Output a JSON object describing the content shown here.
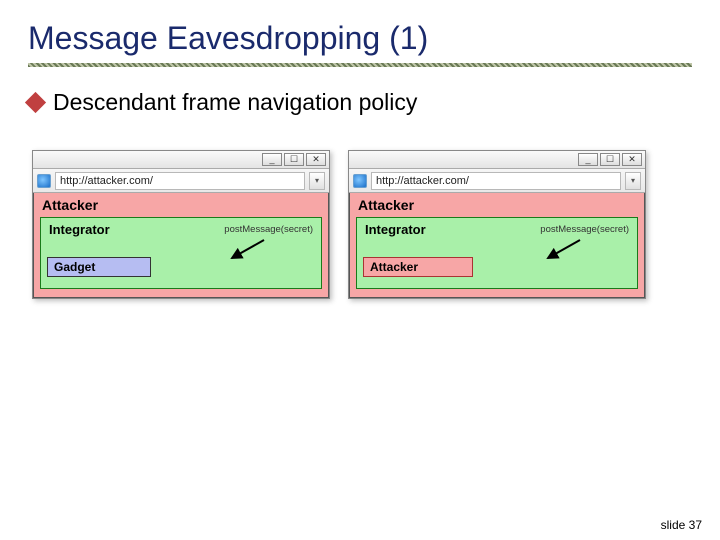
{
  "title": "Message Eavesdropping (1)",
  "bullet": "Descendant frame navigation policy",
  "url": "http://attacker.com/",
  "labels": {
    "attacker": "Attacker",
    "integrator": "Integrator",
    "gadget": "Gadget",
    "msg": "postMessage(secret)"
  },
  "win": {
    "min": "_",
    "max": "☐",
    "close": "✕",
    "dd": "▾"
  },
  "footer": "slide 37"
}
